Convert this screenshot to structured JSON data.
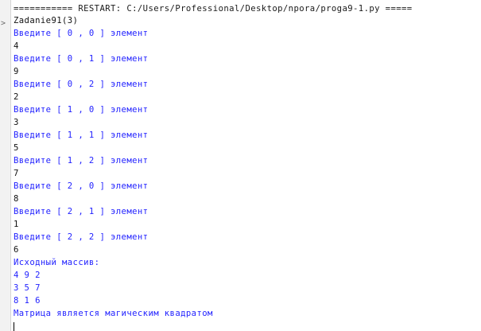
{
  "restart_banner": "=========== RESTART: C:/Users/Professional/Desktop/npora/proga9-1.py =====",
  "gutter": {
    "prompt_symbol": ">"
  },
  "shell_lines": [
    {
      "kind": "input-echo",
      "text": "Zadanie91(3)"
    },
    {
      "kind": "stdout",
      "text": "Введите [ 0 , 0 ] элемент"
    },
    {
      "kind": "user-in",
      "text": "4"
    },
    {
      "kind": "stdout",
      "text": "Введите [ 0 , 1 ] элемент"
    },
    {
      "kind": "user-in",
      "text": "9"
    },
    {
      "kind": "stdout",
      "text": "Введите [ 0 , 2 ] элемент"
    },
    {
      "kind": "user-in",
      "text": "2"
    },
    {
      "kind": "stdout",
      "text": "Введите [ 1 , 0 ] элемент"
    },
    {
      "kind": "user-in",
      "text": "3"
    },
    {
      "kind": "stdout",
      "text": "Введите [ 1 , 1 ] элемент"
    },
    {
      "kind": "user-in",
      "text": "5"
    },
    {
      "kind": "stdout",
      "text": "Введите [ 1 , 2 ] элемент"
    },
    {
      "kind": "user-in",
      "text": "7"
    },
    {
      "kind": "stdout",
      "text": "Введите [ 2 , 0 ] элемент"
    },
    {
      "kind": "user-in",
      "text": "8"
    },
    {
      "kind": "stdout",
      "text": "Введите [ 2 , 1 ] элемент"
    },
    {
      "kind": "user-in",
      "text": "1"
    },
    {
      "kind": "stdout",
      "text": "Введите [ 2 , 2 ] элемент"
    },
    {
      "kind": "user-in",
      "text": "6"
    },
    {
      "kind": "stdout",
      "text": "Исходный массив:"
    },
    {
      "kind": "stdout",
      "text": "4 9 2"
    },
    {
      "kind": "stdout",
      "text": "3 5 7"
    },
    {
      "kind": "stdout",
      "text": "8 1 6"
    },
    {
      "kind": "stdout",
      "text": "Матрица является магическим квадратом"
    }
  ],
  "colors": {
    "stdout": "#1f1fff",
    "user_input": "#111111",
    "gutter_bg": "#f2f2f2"
  }
}
